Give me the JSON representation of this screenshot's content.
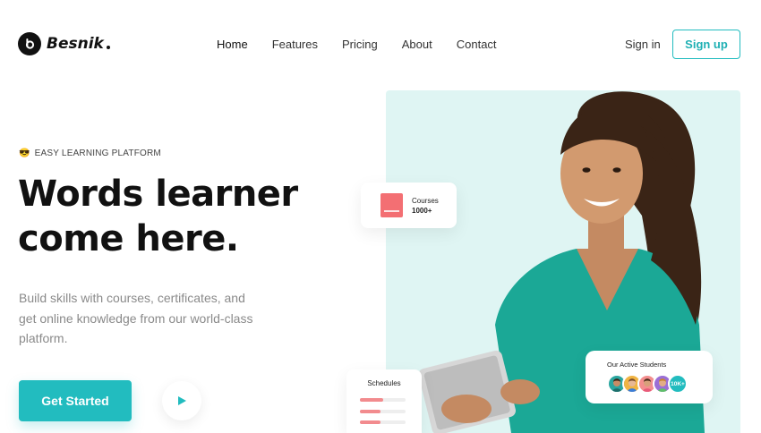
{
  "brand": {
    "name": "Besnik",
    "logo_letter": "b"
  },
  "nav": {
    "items": [
      {
        "label": "Home",
        "active": true
      },
      {
        "label": "Features",
        "active": false
      },
      {
        "label": "Pricing",
        "active": false
      },
      {
        "label": "About",
        "active": false
      },
      {
        "label": "Contact",
        "active": false
      }
    ]
  },
  "auth": {
    "signin_label": "Sign in",
    "signup_label": "Sign up"
  },
  "hero": {
    "tag_emoji": "😎",
    "tag_text": "EASY LEARNING PLATFORM",
    "headline_line1": "Words learner",
    "headline_line2": "come here.",
    "description": "Build skills with courses, certificates, and get online knowledge from our world-class platform.",
    "cta_label": "Get Started",
    "play_icon": "play-icon"
  },
  "cards": {
    "courses": {
      "title": "Courses",
      "count": "1000+"
    },
    "schedules": {
      "title": "Schedules",
      "bars": [
        0.5,
        0.45,
        0.45
      ]
    },
    "students": {
      "title": "Our Active Students",
      "badge": "10K+"
    }
  },
  "colors": {
    "accent": "#22bcbf",
    "hero_bg": "#dff5f3",
    "coral": "#f36f73",
    "text_dark": "#111111",
    "text_muted": "#8a8a8a"
  }
}
